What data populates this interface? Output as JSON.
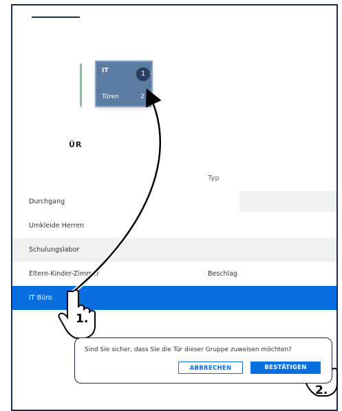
{
  "group_card": {
    "title": "IT",
    "badge": "1",
    "subtitle": "Türen",
    "count": "2"
  },
  "section": {
    "heading": "ÜR"
  },
  "table": {
    "columns": [
      "",
      "Typ"
    ],
    "rows": [
      {
        "name": "Durchgang",
        "type": ""
      },
      {
        "name": "Umkleide Herren",
        "type": ""
      },
      {
        "name": "Schulungslabor",
        "type": ""
      },
      {
        "name": "Eltern-Kinder-Zimmer",
        "type": "Beschlag"
      },
      {
        "name": "IT Büro",
        "type": "",
        "selected": true
      }
    ]
  },
  "dialog": {
    "message": "Sind Sie sicher, dass Sie die Tür dieser Gruppe zuweisen möchten?",
    "cancel_label": "ABBRECHEN",
    "confirm_label": "BESTÄTIGEN"
  },
  "annotations": {
    "step1": "1.",
    "step2": "2.",
    "icons": [
      "hand-pointer-icon",
      "curved-arrow-icon"
    ]
  },
  "colors": {
    "accent": "#0a6ee0",
    "frame": "#1e2a4a",
    "card": "#5d7ca3"
  }
}
